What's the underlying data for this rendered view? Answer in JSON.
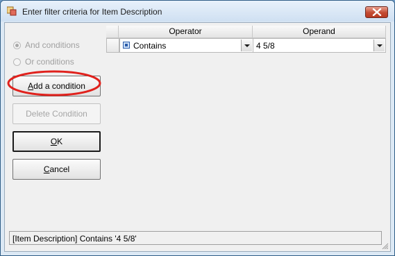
{
  "window": {
    "title": "Enter filter criteria for Item Description",
    "icon": "filter-window-icon",
    "close_icon": "close-icon"
  },
  "options": {
    "and_conditions": {
      "label": "And conditions",
      "selected": true,
      "enabled": false
    },
    "or_conditions": {
      "label": "Or conditions",
      "selected": false,
      "enabled": false
    }
  },
  "buttons": {
    "add_condition": {
      "accel": "A",
      "rest": "dd a condition",
      "enabled": true
    },
    "delete_condition": {
      "label": "Delete Condition",
      "enabled": false
    },
    "ok": {
      "accel": "O",
      "rest": "K",
      "enabled": true
    },
    "cancel": {
      "accel": "C",
      "rest": "ancel",
      "enabled": true
    }
  },
  "grid": {
    "columns": [
      "Operator",
      "Operand"
    ],
    "rows": [
      {
        "operator": "Contains",
        "operand": "4 5/8"
      }
    ]
  },
  "status": {
    "text": "[Item Description] Contains '4 5/8'"
  },
  "colors": {
    "highlight_circle": "#e0211c",
    "title_bar": "#dce9f5",
    "close_button": "#c34b33"
  }
}
